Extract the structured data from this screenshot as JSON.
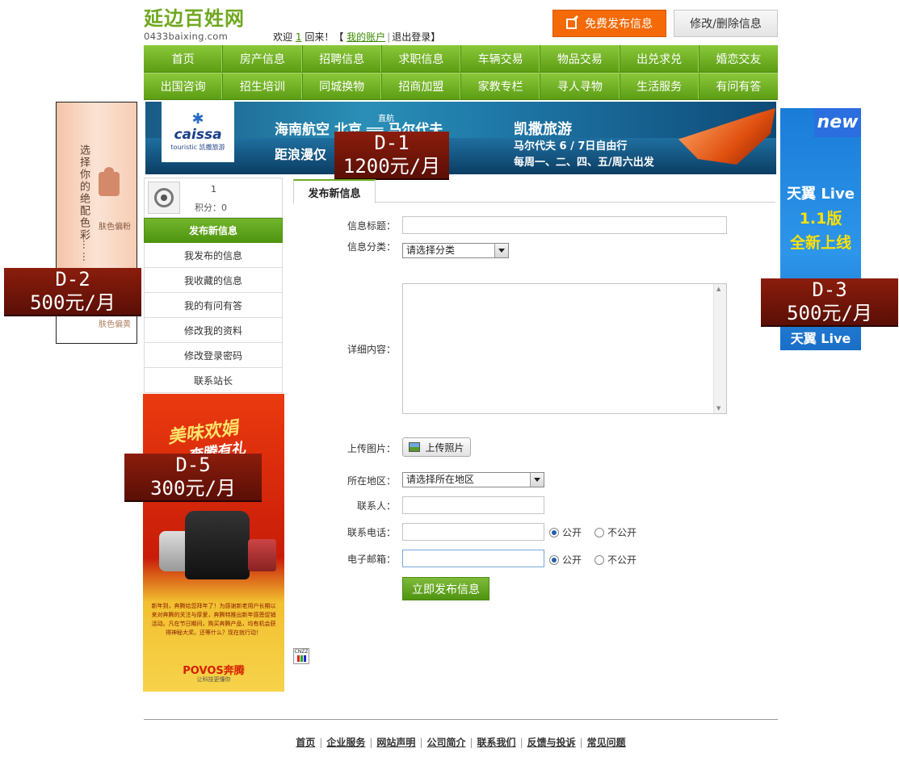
{
  "header": {
    "logo_cn": "延边百姓网",
    "logo_en": "0433baixing.com",
    "welcome_prefix": "欢迎",
    "username": "1",
    "welcome_suffix": "回来！【",
    "my_account": "我的账户",
    "logout": "退出登录",
    "bracket_close": "】",
    "publish_button": "免费发布信息",
    "modify_button": "修改/删除信息"
  },
  "nav": {
    "row1": [
      "首页",
      "房产信息",
      "招聘信息",
      "求职信息",
      "车辆交易",
      "物品交易",
      "出兑求兑",
      "婚恋交友"
    ],
    "row2": [
      "出国咨询",
      "招生培训",
      "同城换物",
      "招商加盟",
      "家教专栏",
      "寻人寻物",
      "生活服务",
      "有问有答"
    ]
  },
  "banner_top": {
    "brand": "caissa",
    "brand_sub": "touristic 凯撒旅游",
    "line1": "海南航空 北京 ══ 马尔代夫",
    "direct": "直航",
    "line2": "距浪漫仅",
    "right1": "凯撒旅游",
    "right2": "马尔代夫 6 / 7日自由行",
    "right3": "每周一、二、四、五/周六出发"
  },
  "ads": {
    "d1": {
      "code": "D-1",
      "price": "1200元/月"
    },
    "d2": {
      "code": "D-2",
      "price": "500元/月"
    },
    "d3": {
      "code": "D-3",
      "price": "500元/月"
    },
    "d5": {
      "code": "D-5",
      "price": "300元/月"
    },
    "left_side": {
      "vertical": "选择你的绝配色彩",
      "dots": "……",
      "label1": "肤色偏粉",
      "label2": "肤色偏黄"
    },
    "right_side": {
      "new": "new",
      "line1": "天翼 Live",
      "line2": "1.1版",
      "line3": "全新上线",
      "line4": "天翼 Live"
    },
    "bottom_left": {
      "head1": "美味欢娟",
      "head2": "奔腾有礼",
      "text": "新年到，奔腾给您拜年了！为感谢新老用户长期以来对奔腾的关注与厚爱，奔腾特推出新年感恩促销活动。凡在节日期间，购买奔腾产品，均有机会获得神秘大奖。还等什么？现在就行动！",
      "brand": "POVOS奔腾",
      "brand_sub": "让科技更懂你"
    }
  },
  "user": {
    "name": "1",
    "score": "积分：0"
  },
  "menu": [
    "发布新信息",
    "我发布的信息",
    "我收藏的信息",
    "我的有问有答",
    "修改我的资料",
    "修改登录密码",
    "联系站长"
  ],
  "form": {
    "tab": "发布新信息",
    "title_label": "信息标题：",
    "title_value": "",
    "category_label": "信息分类：",
    "category_value": "请选择分类",
    "content_label": "详细内容：",
    "upload_label": "上传图片：",
    "upload_button": "上传照片",
    "area_label": "所在地区：",
    "area_value": "请选择所在地区",
    "contact_label": "联系人：",
    "phone_label": "联系电话：",
    "email_label": "电子邮箱：",
    "public": "公开",
    "private": "不公开",
    "submit": "立即发布信息"
  },
  "cnzz": "CNZZ",
  "footer": [
    "首页",
    "企业服务",
    "网站声明",
    "公司简介",
    "联系我们",
    "反馈与投诉",
    "常见问题"
  ]
}
